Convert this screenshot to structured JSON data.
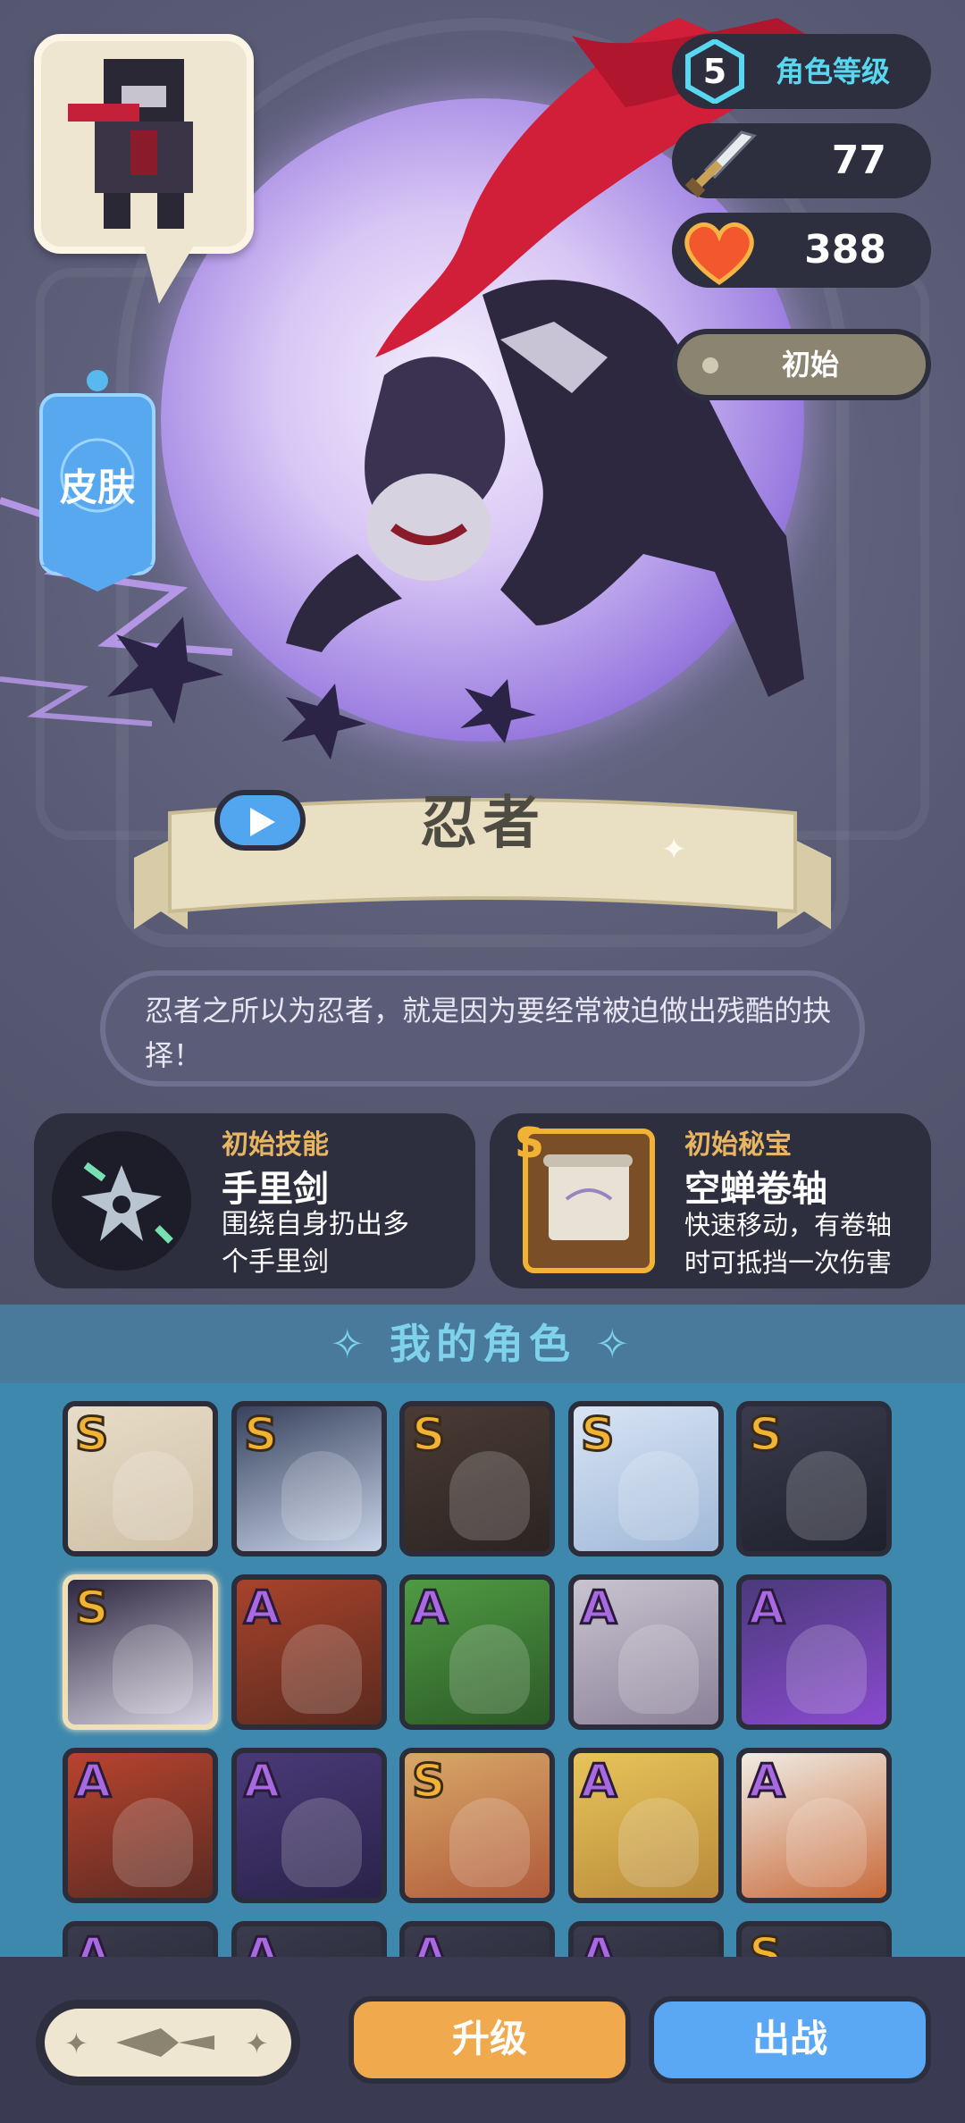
{
  "stats": {
    "level": "5",
    "level_label": "角色等级",
    "attack": "77",
    "health": "388"
  },
  "skin_state": "初始",
  "skin_button": "皮肤",
  "character": {
    "name": "忍者",
    "description": "忍者之所以为忍者，就是因为要经常被迫做出残酷的抉择！"
  },
  "skill_card": {
    "title": "初始技能",
    "name": "手里剑",
    "desc_line1": "围绕自身扔出多",
    "desc_line2": "个手里剑"
  },
  "treasure_card": {
    "rank": "S",
    "title": "初始秘宝",
    "name": "空蝉卷轴",
    "desc_line1": "快速移动，有卷轴",
    "desc_line2": "时可抵挡一次伤害"
  },
  "roster_section": {
    "title": "我的角色",
    "ranks": [
      [
        "S",
        "S",
        "S",
        "S",
        "S"
      ],
      [
        "S",
        "A",
        "A",
        "A",
        "A"
      ],
      [
        "A",
        "A",
        "S",
        "A",
        "A"
      ],
      [
        "A",
        "A",
        "A",
        "A",
        "S"
      ]
    ],
    "selected_index": 5
  },
  "buttons": {
    "upgrade": "升级",
    "deploy": "出战"
  },
  "colors": {
    "accent_blue": "#5aa8f4",
    "accent_orange": "#f0a94d",
    "s_rank": "#f2b233",
    "a_rank": "#a869e3"
  }
}
